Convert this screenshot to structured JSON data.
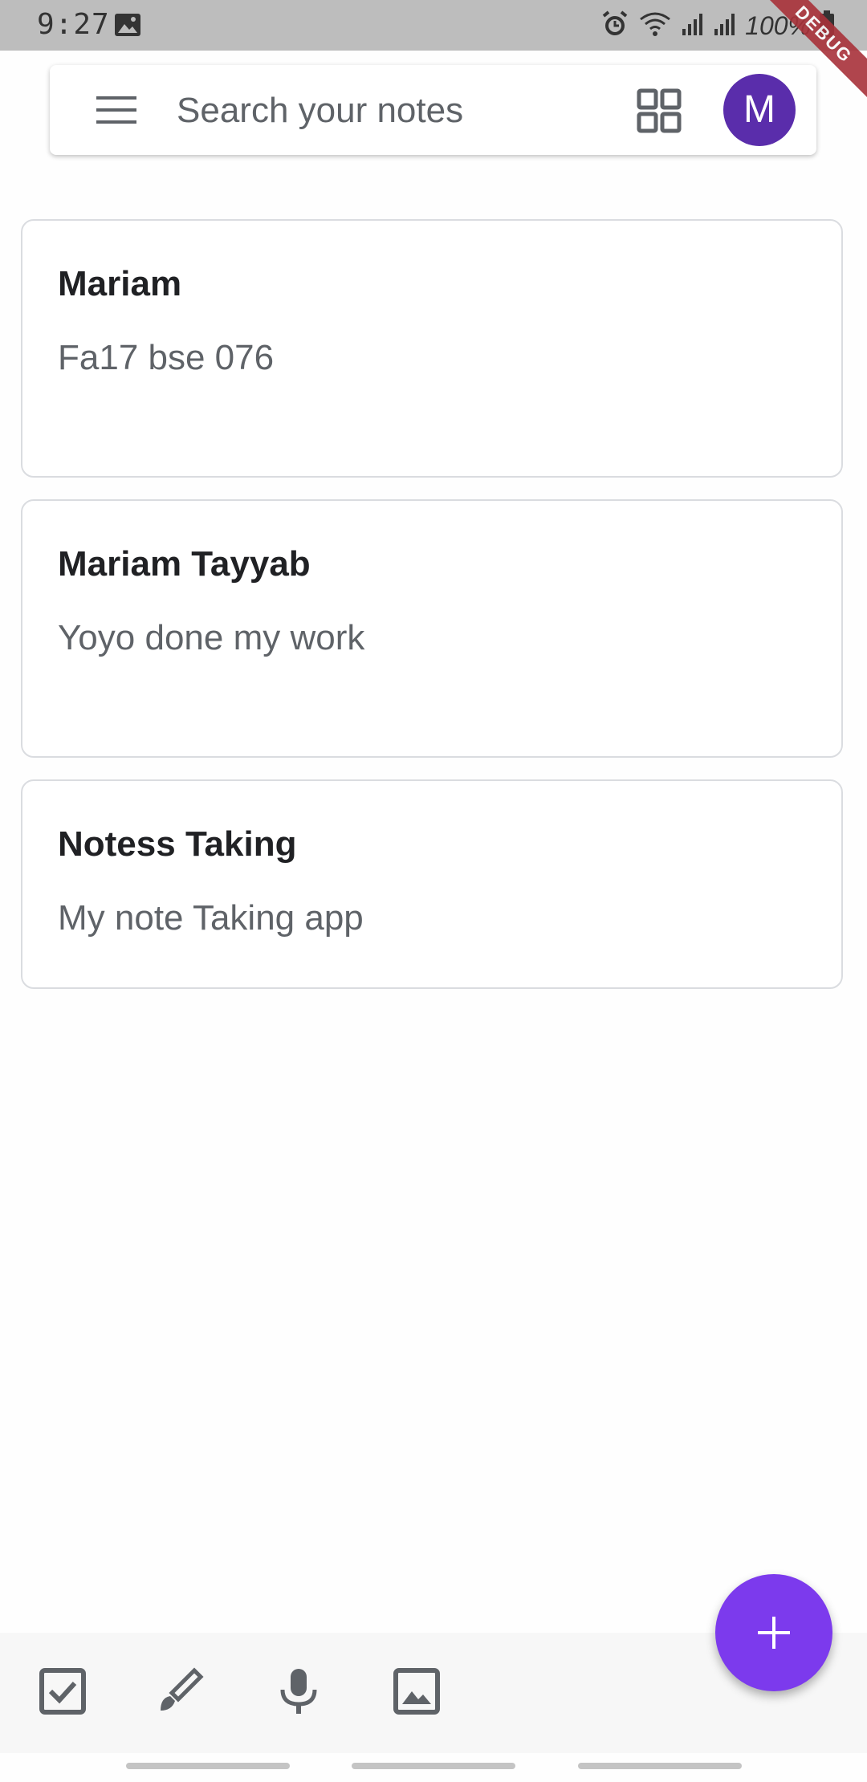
{
  "status_bar": {
    "time": "9:27",
    "battery_percent": "100%",
    "icons": [
      "image-icon",
      "alarm-icon",
      "wifi-icon",
      "signal-icon",
      "signal-icon",
      "battery-icon"
    ]
  },
  "debug_banner": {
    "label": "DEBUG",
    "color": "#a8323a"
  },
  "search_bar": {
    "menu_icon": "menu-icon",
    "placeholder": "Search your notes",
    "view_toggle_icon": "grid-view-icon",
    "avatar_letter": "M",
    "avatar_color": "#5a2dab"
  },
  "notes": [
    {
      "title": "Mariam",
      "body": "Fa17 bse 076"
    },
    {
      "title": "Mariam Tayyab",
      "body": "Yoyo done my work"
    },
    {
      "title": "Notess Taking",
      "body": "My note Taking app"
    }
  ],
  "bottom_toolbar": {
    "items": [
      "checkbox-icon",
      "brush-icon",
      "microphone-icon",
      "image-icon"
    ]
  },
  "fab": {
    "icon": "plus-icon",
    "color": "#7c3aed"
  }
}
